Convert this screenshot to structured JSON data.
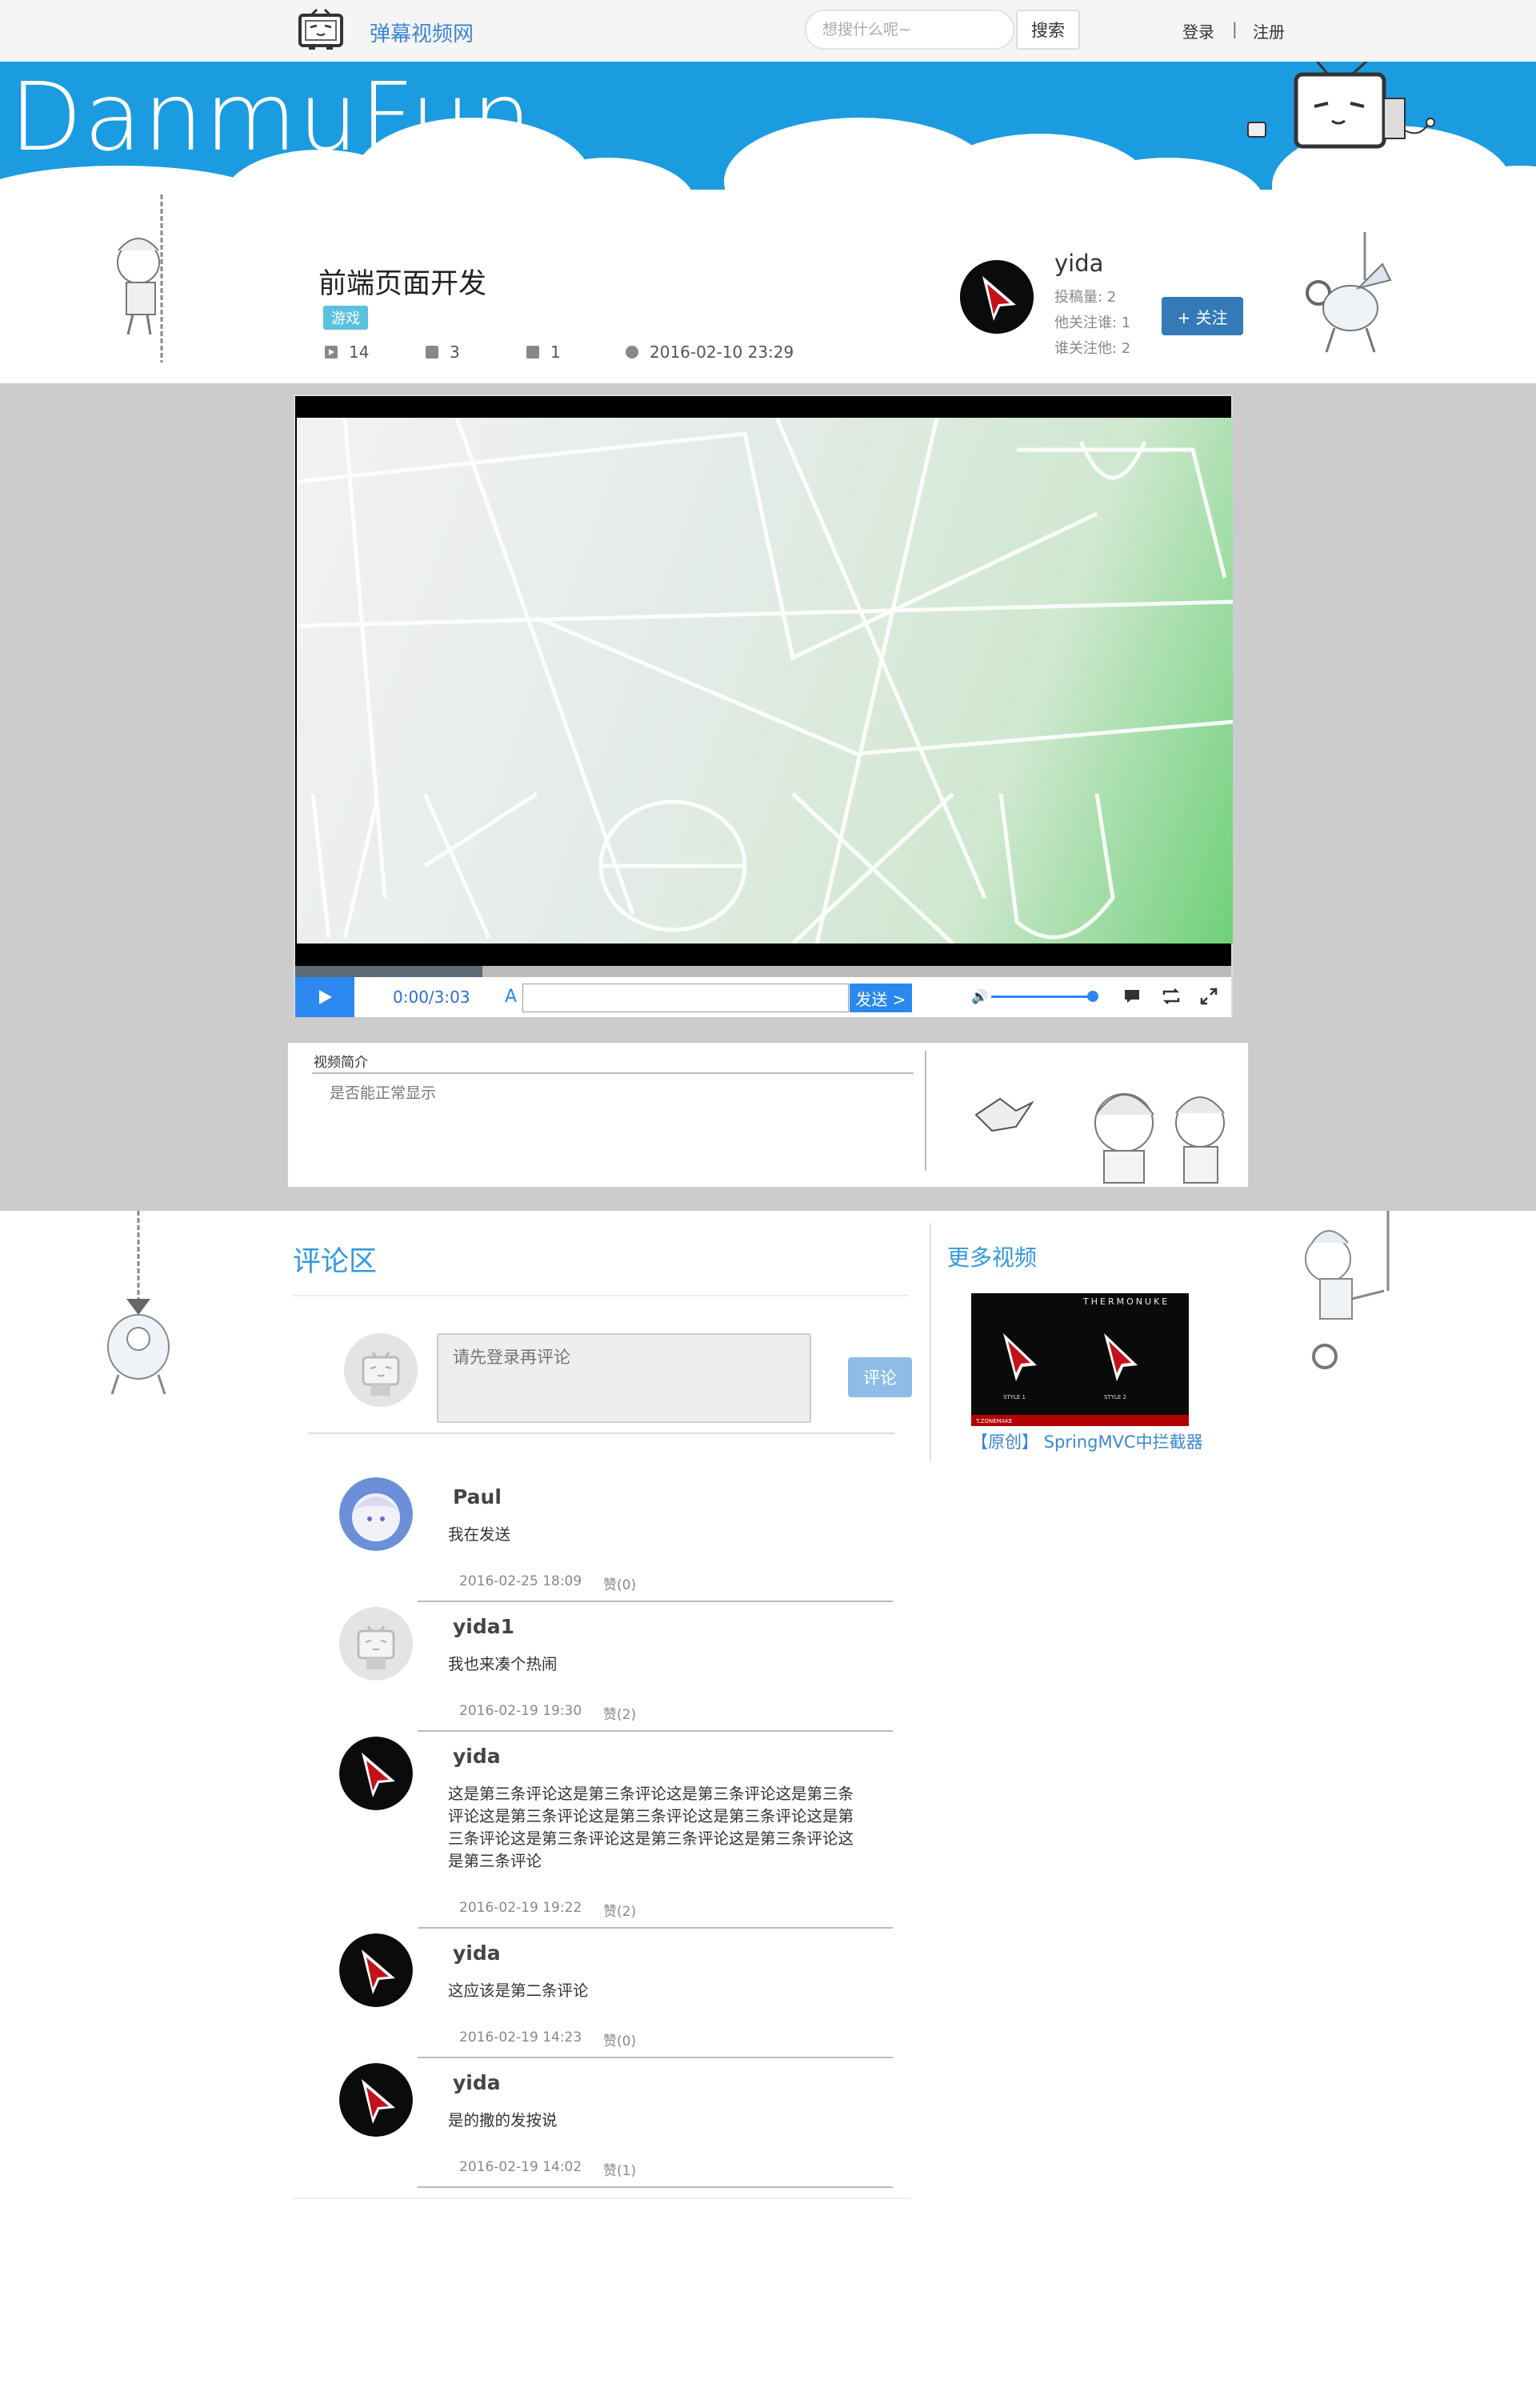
{
  "topbar": {
    "site_name": "弹幕视频网",
    "search_placeholder": "想搜什么呢~",
    "search_button": "搜索",
    "login": "登录",
    "separator": "|",
    "register": "注册"
  },
  "banner": {
    "title": "DanmuFun"
  },
  "video": {
    "title": "前端页面开发",
    "tag": "游戏",
    "plays": "14",
    "danmu_count": "3",
    "favorites": "1",
    "date": "2016-02-10 23:29"
  },
  "uploader": {
    "name": "yida",
    "submissions": "投稿量: 2",
    "following": "他关注谁: 1",
    "followers": "谁关注他: 2",
    "follow_button": "+ 关注"
  },
  "player": {
    "time": "0:00/3:03",
    "danmu_icon": "A",
    "send_button": "发送 >",
    "progress_buffered_fraction": 0.2,
    "volume_fraction": 0.95
  },
  "description": {
    "title": "视频简介",
    "text": "是否能正常显示"
  },
  "comments_section": {
    "title": "评论区",
    "input_placeholder": "请先登录再评论",
    "submit_button": "评论"
  },
  "comments": [
    {
      "user": "Paul",
      "text": "我在发送",
      "time": "2016-02-25 18:09",
      "likes": "赞(0)",
      "avatar": "anime-avatar"
    },
    {
      "user": "yida1",
      "text": "我也来凑个热闹",
      "time": "2016-02-19 19:30",
      "likes": "赞(2)",
      "avatar": "default-tv-avatar"
    },
    {
      "user": "yida",
      "text": "这是第三条评论这是第三条评论这是第三条评论这是第三条评论这是第三条评论这是第三条评论这是第三条评论这是第三条评论这是第三条评论这是第三条评论这是第三条评论这是第三条评论",
      "time": "2016-02-19 19:22",
      "likes": "赞(2)",
      "avatar": "red-arrow-avatar"
    },
    {
      "user": "yida",
      "text": "这应该是第二条评论",
      "time": "2016-02-19 14:23",
      "likes": "赞(0)",
      "avatar": "red-arrow-avatar"
    },
    {
      "user": "yida",
      "text": "是的撒的发按说",
      "time": "2016-02-19 14:02",
      "likes": "赞(1)",
      "avatar": "red-arrow-avatar"
    }
  ],
  "more_videos": {
    "title": "更多视频",
    "items": [
      {
        "title": "【原创】 SpringMVC中拦截器",
        "thumb_header": "THERMONUKE",
        "thumb_labels": [
          "STYLE 1",
          "STYLE 2"
        ],
        "thumb_footer": "T.ZONEMAKE"
      }
    ]
  },
  "colors": {
    "accent": "#3399dd",
    "banner": "#1b9be0",
    "primary_button": "#337ab7",
    "player_blue": "#2b88ee"
  }
}
